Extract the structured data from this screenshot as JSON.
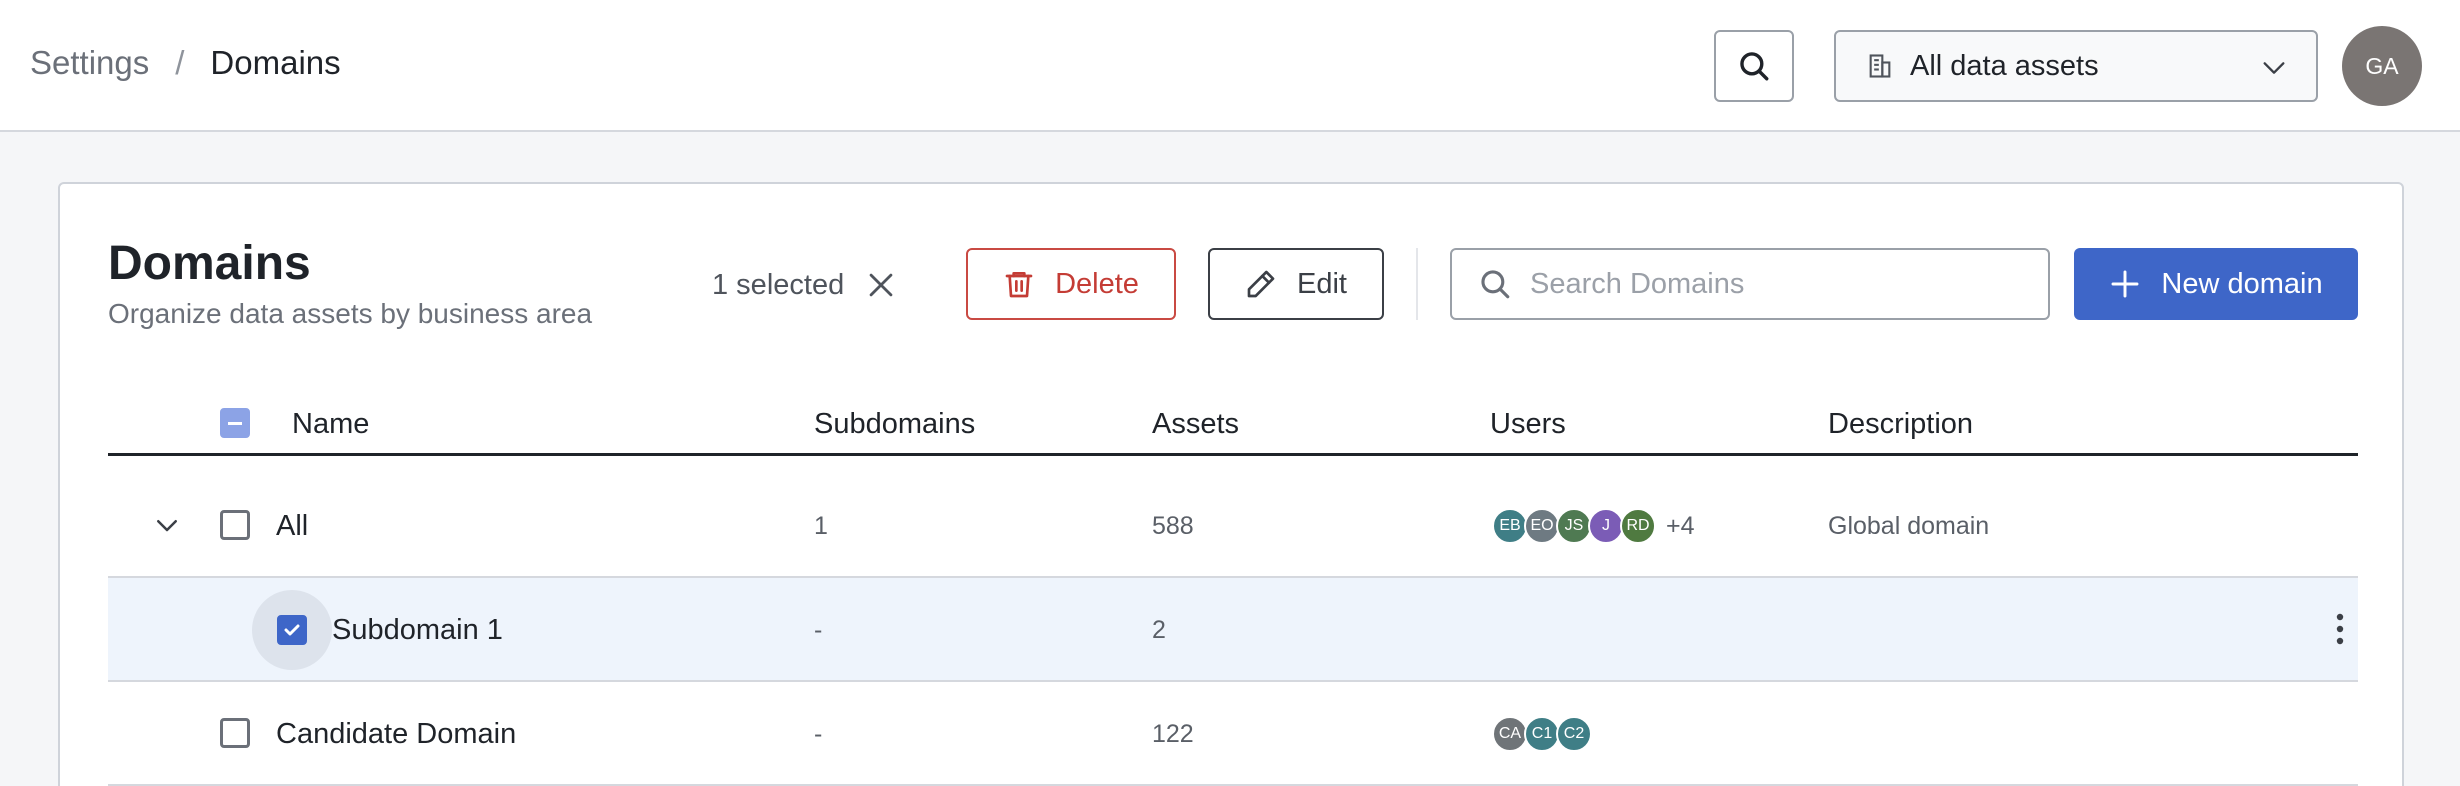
{
  "breadcrumb": {
    "root": "Settings",
    "separator": "/",
    "current": "Domains"
  },
  "header": {
    "asset_filter": "All data assets",
    "user_initials": "GA"
  },
  "page": {
    "title": "Domains",
    "subtitle": "Organize data assets by business area"
  },
  "toolbar": {
    "selected_text": "1 selected",
    "delete_label": "Delete",
    "edit_label": "Edit",
    "search_placeholder": "Search Domains",
    "new_label": "New domain"
  },
  "table": {
    "columns": [
      "Name",
      "Subdomains",
      "Assets",
      "Users",
      "Description"
    ],
    "rows": [
      {
        "name": "All",
        "subdomains": "1",
        "assets": "588",
        "users": [
          {
            "initials": "EB",
            "color": "#3f7e86"
          },
          {
            "initials": "EO",
            "color": "#6e7a82"
          },
          {
            "initials": "JS",
            "color": "#4f7a52"
          },
          {
            "initials": "J",
            "color": "#7b5cb6"
          },
          {
            "initials": "RD",
            "color": "#4f7a40"
          }
        ],
        "more_users": "+4",
        "description": "Global domain"
      },
      {
        "name": "Subdomain 1",
        "subdomains": "-",
        "assets": "2",
        "users": [],
        "more_users": "",
        "description": ""
      },
      {
        "name": "Candidate Domain",
        "subdomains": "-",
        "assets": "122",
        "users": [
          {
            "initials": "CA",
            "color": "#6f7478"
          },
          {
            "initials": "C1",
            "color": "#3f7e86"
          },
          {
            "initials": "C2",
            "color": "#3f7e86"
          }
        ],
        "more_users": "",
        "description": ""
      }
    ]
  },
  "colors": {
    "primary": "#3e66c8",
    "danger": "#c43c35",
    "selected_row": "#eef4fc"
  },
  "icons": [
    "search-icon",
    "building-icon",
    "chevron-down-icon",
    "close-icon",
    "trash-icon",
    "pencil-icon",
    "plus-icon",
    "check-icon",
    "kebab-menu-icon"
  ]
}
